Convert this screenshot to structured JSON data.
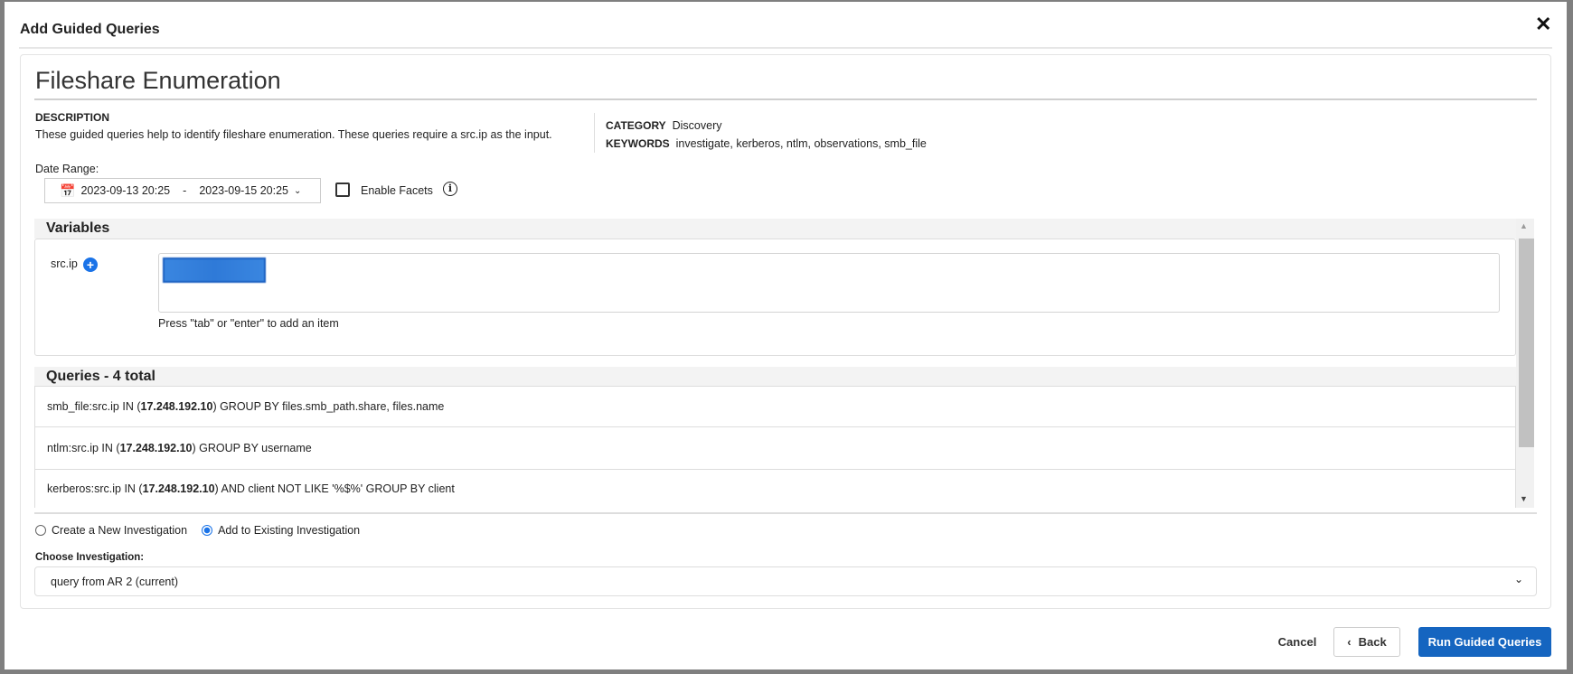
{
  "dialog": {
    "title": "Add Guided Queries",
    "close_icon": "close-icon"
  },
  "query": {
    "title": "Fileshare Enumeration",
    "description_label": "DESCRIPTION",
    "description": "These guided queries help to identify fileshare enumeration. These queries require a src.ip as the input.",
    "category_label": "CATEGORY",
    "category": "Discovery",
    "keywords_label": "KEYWORDS",
    "keywords": "investigate, kerberos, ntlm, observations, smb_file"
  },
  "date_range": {
    "label": "Date Range:",
    "start": "2023-09-13 20:25",
    "separator": "-",
    "end": "2023-09-15 20:25"
  },
  "facets": {
    "label": "Enable Facets",
    "checked": false
  },
  "variables": {
    "header": "Variables",
    "name": "src.ip",
    "hint": "Press \"tab\" or \"enter\" to add an item"
  },
  "queries": {
    "header": "Queries - 4 total",
    "items": [
      {
        "pre": "smb_file:src.ip IN ( ",
        "ip": "17.248.192.10",
        "post": " ) GROUP BY files.smb_path.share, files.name"
      },
      {
        "pre": "ntlm:src.ip IN ( ",
        "ip": "17.248.192.10",
        "post": " ) GROUP BY username"
      },
      {
        "pre": "kerberos:src.ip IN ( ",
        "ip": "17.248.192.10",
        "post": " ) AND client NOT LIKE '%$%' GROUP BY client"
      }
    ]
  },
  "investigation": {
    "option_new": "Create a New Investigation",
    "option_existing": "Add to Existing Investigation",
    "selected": "existing",
    "choose_label": "Choose Investigation:",
    "value": "query from AR 2 (current)"
  },
  "footer": {
    "cancel": "Cancel",
    "back": "Back",
    "run": "Run Guided Queries"
  },
  "colors": {
    "primary": "#1565c0",
    "accent": "#1a73e8"
  }
}
